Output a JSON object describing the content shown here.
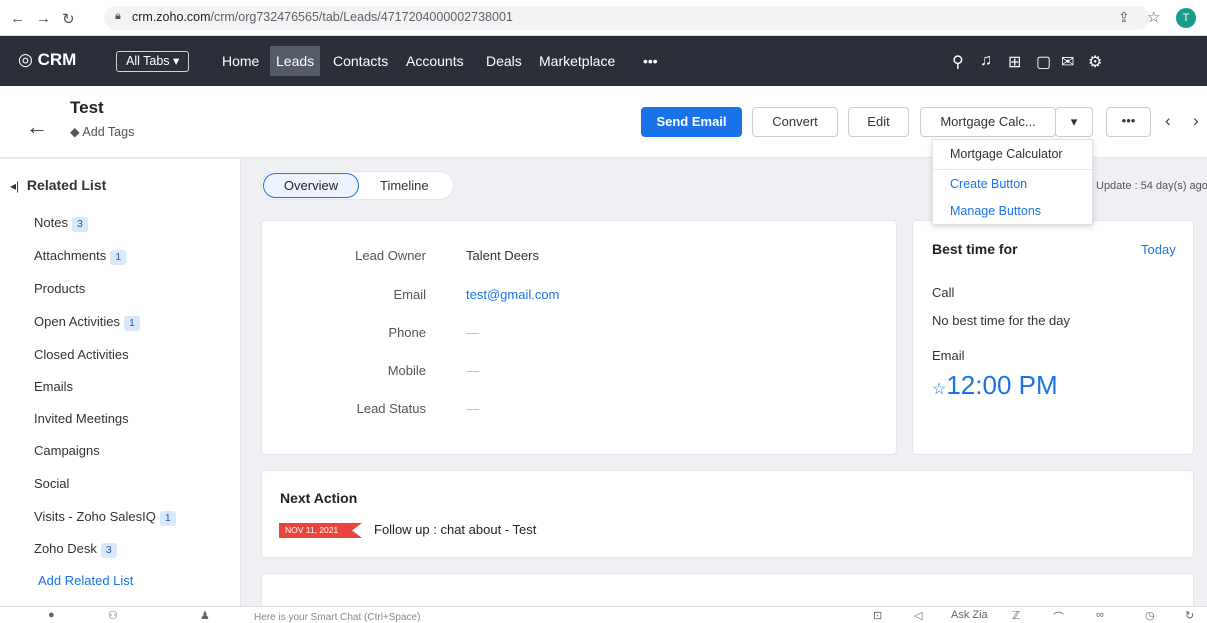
{
  "browser": {
    "url_host": "crm.zoho.com",
    "url_path": "/crm/org732476565/tab/Leads/4717204000002738001",
    "avatar_letter": "T"
  },
  "app": {
    "logo": "CRM",
    "all_tabs": "All Tabs ▾",
    "nav": [
      "Home",
      "Leads",
      "Contacts",
      "Accounts",
      "Deals",
      "Marketplace",
      "•••"
    ]
  },
  "record": {
    "title": "Test",
    "add_tags": "Add Tags",
    "buttons": {
      "send_email": "Send Email",
      "convert": "Convert",
      "edit": "Edit",
      "mortgage": "Mortgage Calc...",
      "more": "•••"
    }
  },
  "dropdown": {
    "items": [
      "Mortgage Calculator",
      "Create Button",
      "Manage Buttons"
    ]
  },
  "sidebar": {
    "heading": "Related List",
    "items": [
      {
        "label": "Notes",
        "count": "3"
      },
      {
        "label": "Attachments",
        "count": "1"
      },
      {
        "label": "Products",
        "count": ""
      },
      {
        "label": "Open Activities",
        "count": "1"
      },
      {
        "label": "Closed Activities",
        "count": ""
      },
      {
        "label": "Emails",
        "count": ""
      },
      {
        "label": "Invited Meetings",
        "count": ""
      },
      {
        "label": "Campaigns",
        "count": ""
      },
      {
        "label": "Social",
        "count": ""
      },
      {
        "label": "Visits - Zoho SalesIQ",
        "count": "1"
      },
      {
        "label": "Zoho Desk",
        "count": "3"
      }
    ],
    "add_related": "Add Related List"
  },
  "tabs": {
    "overview": "Overview",
    "timeline": "Timeline"
  },
  "last_update": "Update : 54 day(s) ago",
  "fields": [
    {
      "label": "Lead Owner",
      "value": "Talent Deers"
    },
    {
      "label": "Email",
      "value": "test@gmail.com"
    },
    {
      "label": "Phone",
      "value": "—"
    },
    {
      "label": "Mobile",
      "value": "—"
    },
    {
      "label": "Lead Status",
      "value": "—"
    }
  ],
  "best_time": {
    "title": "Best time for",
    "today": "Today",
    "call_label": "Call",
    "call_value": "No best time for the day",
    "email_label": "Email",
    "email_time": "12:00 PM"
  },
  "next_action": {
    "title": "Next Action",
    "date": "NOV 11, 2021",
    "text": "Follow up : chat about - Test"
  },
  "bottom": {
    "chat_hint": "Here is your Smart Chat (Ctrl+Space)",
    "ask_zia": "Ask Zia"
  }
}
